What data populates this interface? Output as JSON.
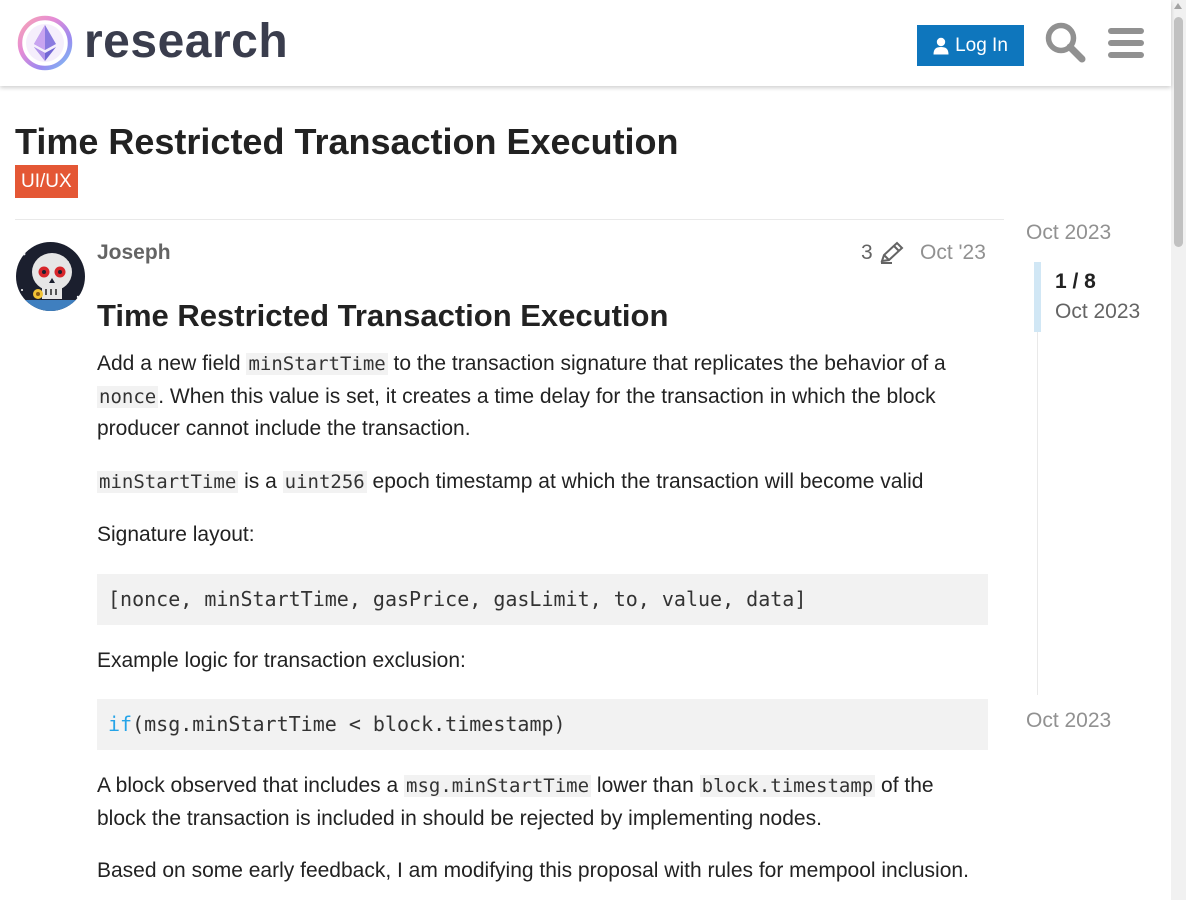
{
  "header": {
    "logo_text": "research",
    "login_label": "Log In"
  },
  "topic": {
    "title": "Time Restricted Transaction Execution",
    "category": "UI/UX"
  },
  "post": {
    "username": "Joseph",
    "edit_count": "3",
    "date": "Oct '23",
    "heading": "Time Restricted Transaction Execution",
    "p1": {
      "t1": "Add a new field ",
      "c1": "minStartTime",
      "t2": " to the transaction signature that replicates the behavior of a ",
      "c2": "nonce",
      "t3": ". When this value is set, it creates a time delay for the transaction in which the block producer cannot include the transaction."
    },
    "p2": {
      "c1": "minStartTime",
      "t1": " is a ",
      "c2": "uint256",
      "t2": " epoch timestamp at which the transaction will become valid"
    },
    "p3": "Signature layout:",
    "code1": "[nonce, minStartTime, gasPrice, gasLimit, to, value, data]",
    "p4": "Example logic for transaction exclusion:",
    "code2": {
      "keyword": "if",
      "rest": "(msg.minStartTime < block.timestamp)"
    },
    "p5": {
      "t1": "A block observed that includes a ",
      "c1": "msg.minStartTime",
      "t2": " lower than ",
      "c2": "block.timestamp",
      "t3": " of the block the transaction is included in should be rejected by implementing nodes."
    },
    "p6": "Based on some early feedback, I am modifying this proposal with rules for mempool inclusion."
  },
  "timeline": {
    "start": "Oct 2023",
    "position": "1 / 8",
    "current_date": "Oct 2023",
    "end": "Oct 2023"
  },
  "colors": {
    "brand_blue": "#0e76bd",
    "category": "#e45735",
    "keyword": "#25a4e8"
  }
}
